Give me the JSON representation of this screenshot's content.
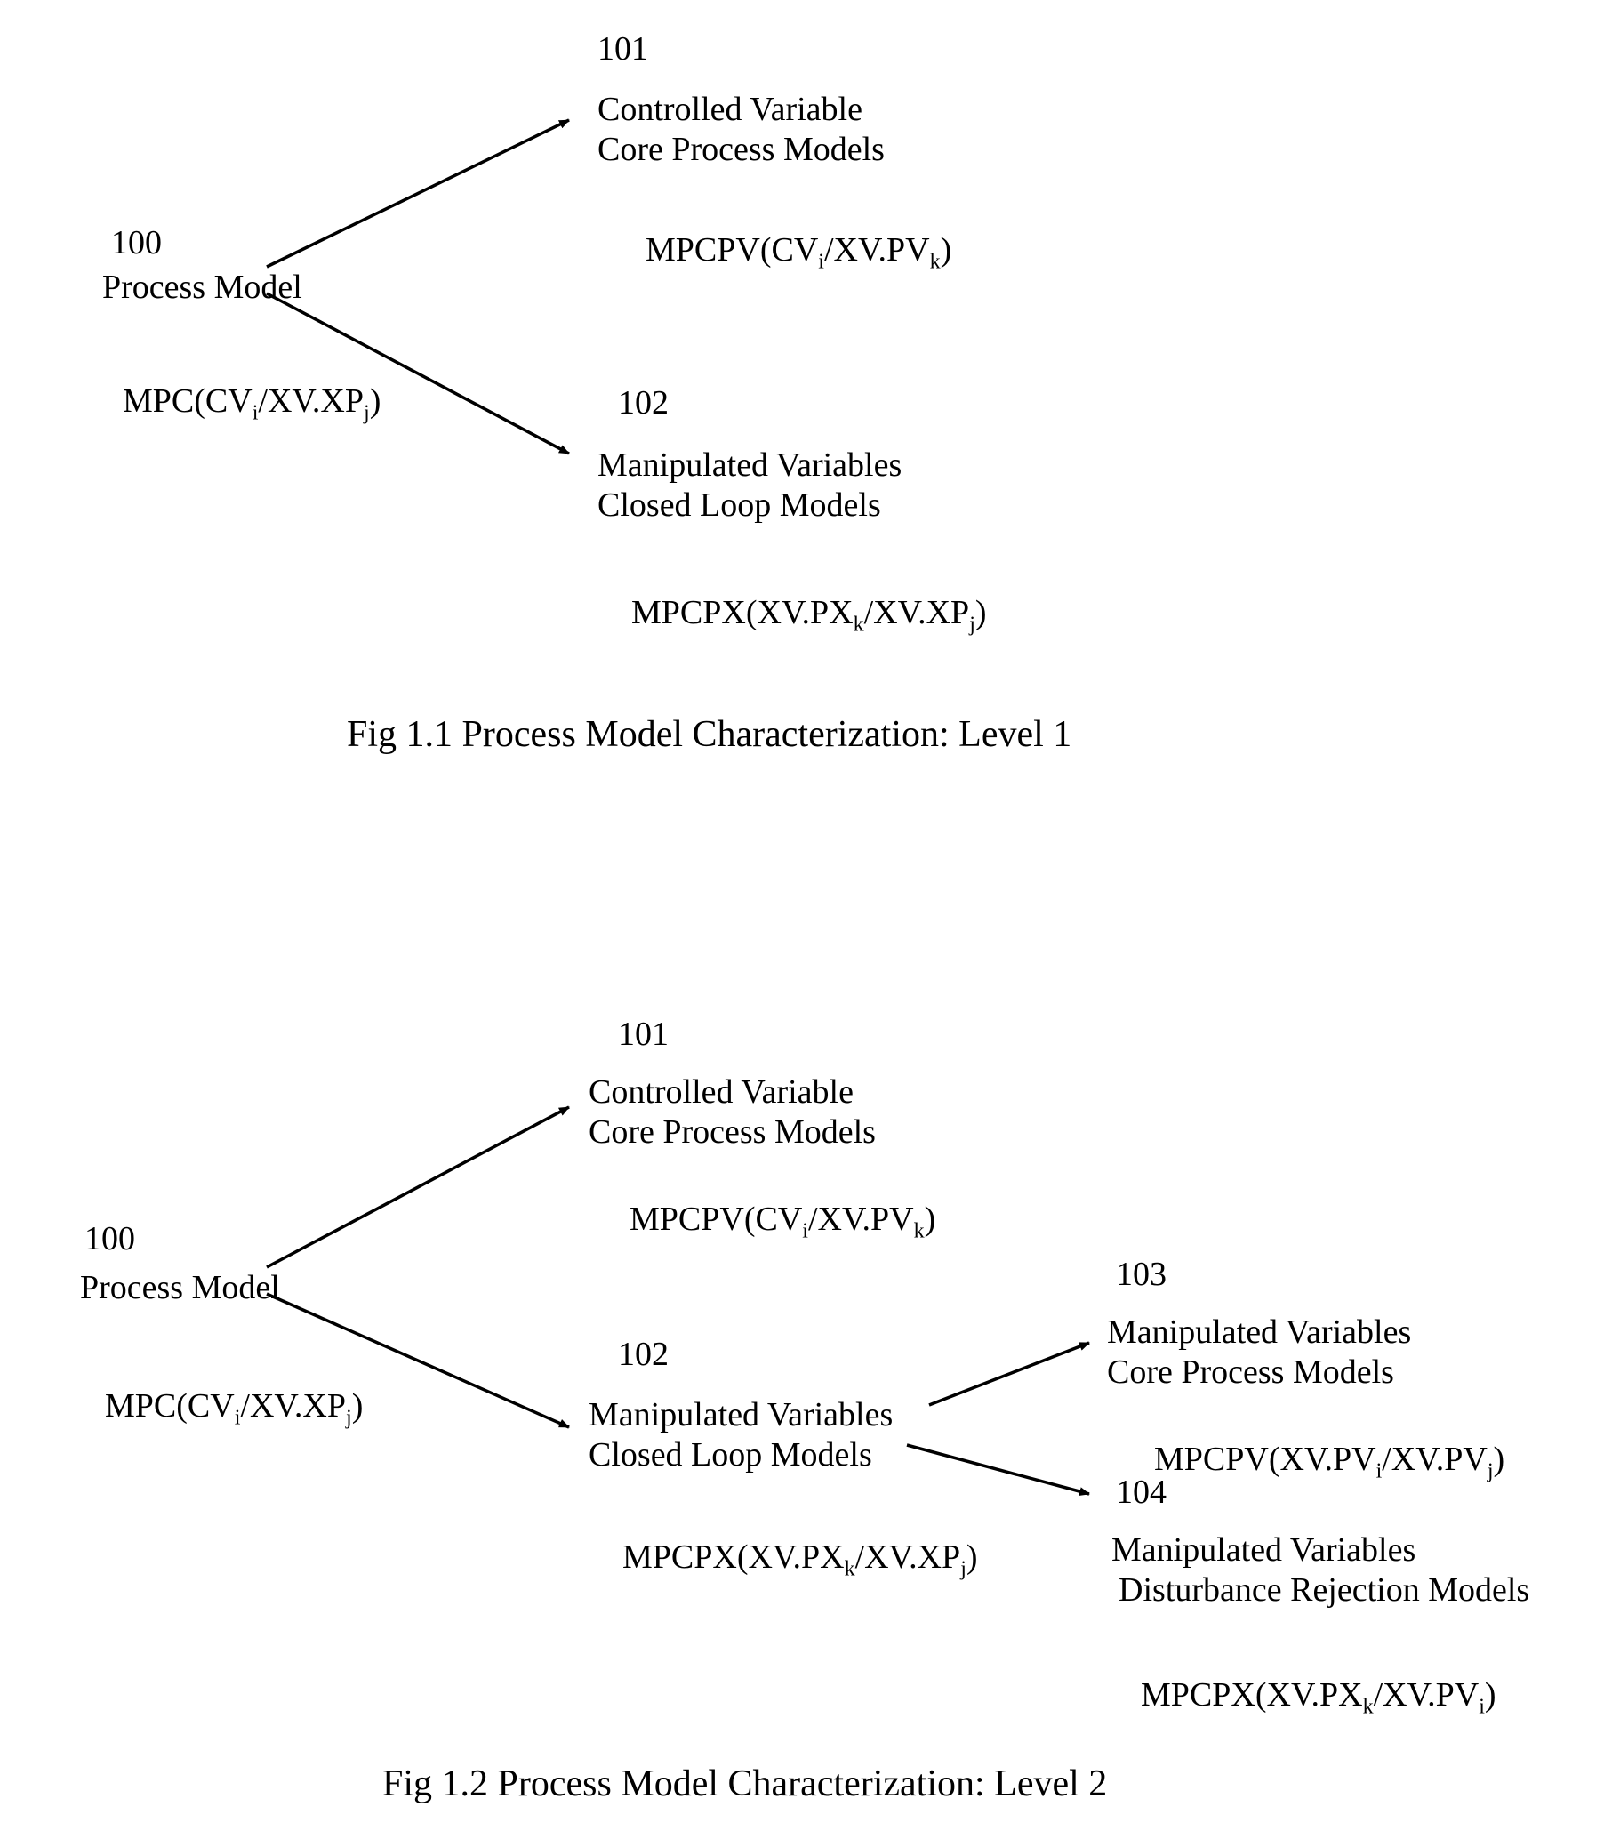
{
  "fig1": {
    "node100": {
      "num": "100",
      "title": "Process Model",
      "formula_prefix": "MPC(CV",
      "formula_sub1": "i",
      "formula_mid": "/XV.XP",
      "formula_sub2": "j",
      "formula_suffix": ")"
    },
    "node101": {
      "num": "101",
      "line1": "Controlled Variable",
      "line2": "Core Process Models",
      "formula_prefix": "MPCPV(CV",
      "formula_sub1": "i",
      "formula_mid": "/XV.PV",
      "formula_sub2": "k",
      "formula_suffix": ")"
    },
    "node102": {
      "num": "102",
      "line1": "Manipulated Variables",
      "line2": "Closed Loop Models",
      "formula_prefix": "MPCPX(XV.PX",
      "formula_sub1": "k",
      "formula_mid": "/XV.XP",
      "formula_sub2": "j",
      "formula_suffix": ")"
    },
    "caption": "Fig 1.1 Process Model Characterization: Level 1"
  },
  "fig2": {
    "node100": {
      "num": "100",
      "title": "Process Model",
      "formula_prefix": "MPC(CV",
      "formula_sub1": "i",
      "formula_mid": "/XV.XP",
      "formula_sub2": "j",
      "formula_suffix": ")"
    },
    "node101": {
      "num": "101",
      "line1": "Controlled Variable",
      "line2": "Core Process Models",
      "formula_prefix": "MPCPV(CV",
      "formula_sub1": "i",
      "formula_mid": "/XV.PV",
      "formula_sub2": "k",
      "formula_suffix": ")"
    },
    "node102": {
      "num": "102",
      "line1": "Manipulated Variables",
      "line2": "Closed Loop Models",
      "formula_prefix": "MPCPX(XV.PX",
      "formula_sub1": "k",
      "formula_mid": "/XV.XP",
      "formula_sub2": "j",
      "formula_suffix": ")"
    },
    "node103": {
      "num": "103",
      "line1": "Manipulated Variables",
      "line2": "Core Process Models",
      "formula_prefix": "MPCPV(XV.PV",
      "formula_sub1": "i",
      "formula_mid": "/XV.PV",
      "formula_sub2": "j",
      "formula_suffix": ")"
    },
    "node104": {
      "num": "104",
      "line1": "Manipulated Variables",
      "line2": "Disturbance Rejection Models",
      "formula_prefix": "MPCPX(XV.PX",
      "formula_sub1": "k",
      "formula_mid": "/XV.PV",
      "formula_sub2": "i",
      "formula_suffix": ")"
    },
    "caption": "Fig 1.2 Process Model Characterization: Level 2"
  }
}
